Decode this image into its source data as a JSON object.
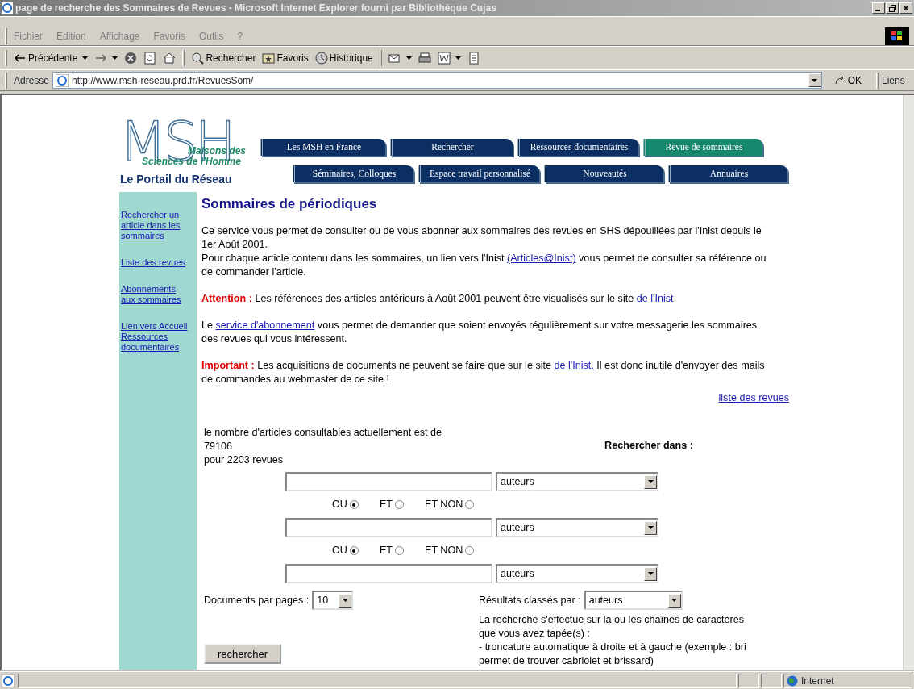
{
  "window": {
    "title": "page de recherche des Sommaires de Revues - Microsoft Internet Explorer fourni par Bibliothèque Cujas"
  },
  "menu_bar": [
    "Fichier",
    "Edition",
    "Affichage",
    "Favoris",
    "Outils",
    "?"
  ],
  "toolbar": [
    {
      "kind": "back",
      "label": "Précédente"
    },
    {
      "kind": "forward"
    },
    {
      "kind": "stop"
    },
    {
      "kind": "refresh"
    },
    {
      "kind": "home"
    },
    {
      "kind": "search",
      "label": "Rechercher"
    },
    {
      "kind": "favorites",
      "label": "Favoris"
    },
    {
      "kind": "history",
      "label": "Historique"
    },
    {
      "kind": "mail"
    },
    {
      "kind": "print"
    },
    {
      "kind": "edit"
    },
    {
      "kind": "discuss"
    }
  ],
  "address_bar": {
    "label": "Adresse",
    "url": "http://www.msh-reseau.prd.fr/RevuesSom/",
    "go": "OK",
    "links": "Liens"
  },
  "logo": {
    "letters": "MSH",
    "line_1": "Maisons des",
    "line_2": "Sciences de l'Homme",
    "tagline": "Le Portail du Réseau"
  },
  "nav_tabs": [
    [
      {
        "label": "Les MSH en France",
        "selected": false
      },
      {
        "label": "Rechercher",
        "selected": false
      },
      {
        "label": "Ressources documentaires",
        "selected": false
      },
      {
        "label": "Revue de sommaires",
        "selected": true
      }
    ],
    [
      {
        "label": "Séminaires, Colloques",
        "selected": false
      },
      {
        "label": "Espace travail personnalisé",
        "selected": false
      },
      {
        "label": "Nouveautés",
        "selected": false
      },
      {
        "label": "Annuaires",
        "selected": false
      }
    ]
  ],
  "sidebar": {
    "items": [
      "Rechercher un article dans les sommaires",
      "Liste des revues",
      "Abonnements aux sommaires",
      "Lien vers Accueil Ressources documentaires"
    ]
  },
  "heading": "Sommaires de périodiques",
  "paragraphs": [
    {
      "lines": [
        [
          {
            "kind": "text",
            "text": "Ce service vous permet de consulter ou de vous abonner aux sommaires des revues en SHS dépouillées par l'Inist depuis le 1er Août 2001."
          }
        ],
        [
          {
            "kind": "text",
            "text": "Pour chaque article contenu dans les sommaires, un lien vers l'Inist "
          },
          {
            "kind": "link",
            "text": "(Articles@Inist)"
          },
          {
            "kind": "text",
            "text": " vous permet de consulter sa référence ou de commander l'article."
          }
        ]
      ]
    },
    {
      "lines": [
        [
          {
            "kind": "alert",
            "text": "Attention :"
          },
          {
            "kind": "text",
            "text": " Les références des articles antérieurs à Août 2001 peuvent être visualisés sur le site "
          },
          {
            "kind": "link",
            "text": "de l'Inist"
          }
        ]
      ]
    },
    {
      "lines": [
        [
          {
            "kind": "text",
            "text": "Le "
          },
          {
            "kind": "link",
            "text": "service d'abonnement"
          },
          {
            "kind": "text",
            "text": " vous permet de demander que soient envoyés régulièrement sur votre messagerie les sommaires des revues qui vous intéressent."
          }
        ]
      ]
    },
    {
      "lines": [
        [
          {
            "kind": "alert",
            "text": "Important :"
          },
          {
            "kind": "text",
            "text": " Les acquisitions de documents ne peuvent se faire que sur le site "
          },
          {
            "kind": "link",
            "text": "de l'Inist."
          },
          {
            "kind": "text",
            "text": " Il est donc inutile d'envoyer des mails de commandes au webmaster de ce site !"
          }
        ]
      ]
    }
  ],
  "list_link": "liste des revues",
  "counter": [
    "le nombre d'articles consultables actuellement est de",
    "79106",
    "pour 2203 revues"
  ],
  "search_in_label": "Rechercher dans :",
  "search_rows": [
    {
      "value": "",
      "field": "auteurs"
    },
    {
      "value": "",
      "field": "auteurs"
    },
    {
      "value": "",
      "field": "auteurs"
    }
  ],
  "operators": [
    [
      {
        "label": "OU",
        "selected": true
      },
      {
        "label": "ET",
        "selected": false
      },
      {
        "label": "ET NON",
        "selected": false
      }
    ],
    [
      {
        "label": "OU",
        "selected": true
      },
      {
        "label": "ET",
        "selected": false
      },
      {
        "label": "ET NON",
        "selected": false
      }
    ]
  ],
  "per_page": {
    "label": "Documents par pages :",
    "value": "10"
  },
  "sort": {
    "label": "Résultats classés par :",
    "value": "auteurs"
  },
  "submit": "rechercher",
  "help": [
    "La recherche s'effectue sur la ou les chaînes de caractères que vous avez tapée(s) :",
    "- troncature automatique à droite et à gauche (exemple : bri permet de trouver cabriolet et brissard)"
  ],
  "status_bar": {
    "zone": "Internet"
  }
}
